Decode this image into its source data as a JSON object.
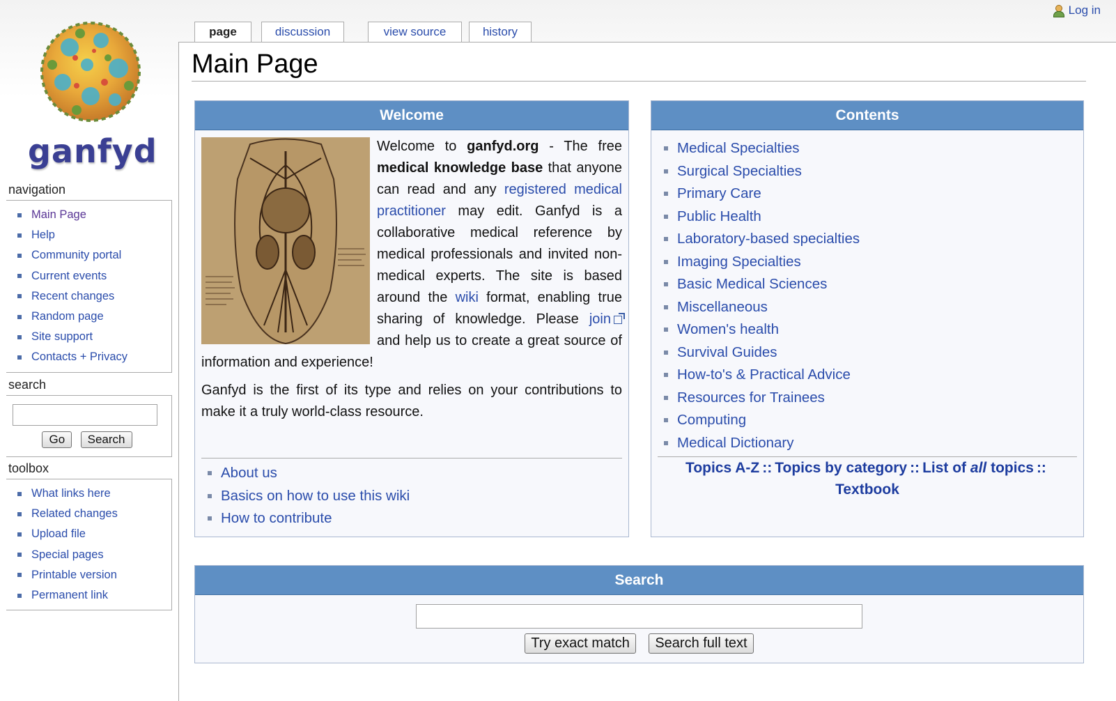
{
  "personal": {
    "login_label": "Log in"
  },
  "logo": {
    "text": "ganfyd"
  },
  "tabs": [
    {
      "label": "page",
      "selected": true
    },
    {
      "label": "discussion",
      "selected": false
    },
    {
      "label": "view source",
      "selected": false
    },
    {
      "label": "history",
      "selected": false
    }
  ],
  "page_title": "Main Page",
  "sidebar": {
    "navigation": {
      "title": "navigation",
      "items": [
        "Main Page",
        "Help",
        "Community portal",
        "Current events",
        "Recent changes",
        "Random page",
        "Site support",
        "Contacts + Privacy"
      ]
    },
    "search": {
      "title": "search",
      "input_value": "",
      "go_label": "Go",
      "search_label": "Search"
    },
    "toolbox": {
      "title": "toolbox",
      "items": [
        "What links here",
        "Related changes",
        "Upload file",
        "Special pages",
        "Printable version",
        "Permanent link"
      ]
    }
  },
  "welcome": {
    "title": "Welcome",
    "p1": {
      "t1": "Welcome to ",
      "b1": "ganfyd.org",
      "t2": " - The free ",
      "b2": "medical knowledge base",
      "t3": " that anyone can read and any ",
      "link1": "registered medical practitioner",
      "t4": " may edit. Ganfyd is a collaborative medical reference by medical professionals and invited non-medical experts. The site is based around the ",
      "link2": "wiki",
      "t5": " format, enabling true sharing of knowledge. Please ",
      "link3": "join",
      "t6": " and help us to create a great source of information and experience!"
    },
    "p2": "Ganfyd is the first of its type and relies on your contributions to make it a truly world-class resource.",
    "links": [
      "About us",
      "Basics on how to use this wiki",
      "How to contribute"
    ]
  },
  "contents": {
    "title": "Contents",
    "items": [
      "Medical Specialties",
      "Surgical Specialties",
      "Primary Care",
      "Public Health",
      "Laboratory-based specialties",
      "Imaging Specialties",
      "Basic Medical Sciences",
      "Miscellaneous",
      "Women's health",
      "Survival Guides",
      "How-to's & Practical Advice",
      "Resources for Trainees",
      "Computing",
      "Medical Dictionary"
    ],
    "topics": {
      "a_z": "Topics A-Z",
      "by_category": "Topics by category",
      "list_prefix": "List of ",
      "list_all": "all",
      "list_suffix": " topics",
      "textbook": "Textbook",
      "separator": "::"
    }
  },
  "searchbox": {
    "title": "Search",
    "input_value": "",
    "exact_label": "Try exact match",
    "full_label": "Search full text"
  }
}
